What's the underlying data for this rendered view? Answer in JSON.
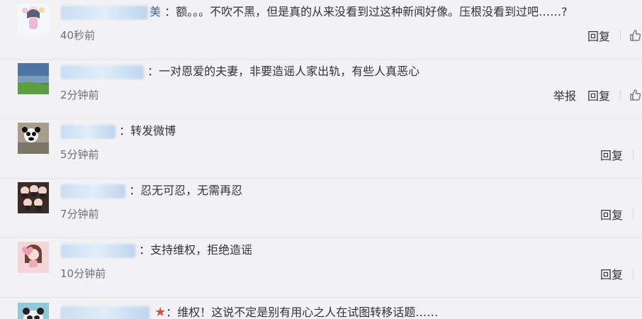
{
  "comments": [
    {
      "username_visible": "美",
      "text": "额。。。不吹不黑，但是真的从来没看到过这种新闻好像。压根没看到过吧……?",
      "time": "40秒前",
      "actions": {
        "reply": "回复"
      }
    },
    {
      "username_visible": "",
      "text": "一对恩爱的夫妻，非要造谣人家出轨，有些人真恶心",
      "time": "2分钟前",
      "actions": {
        "report": "举报",
        "reply": "回复"
      }
    },
    {
      "username_visible": "",
      "text": "转发微博",
      "time": "5分钟前",
      "actions": {
        "reply": "回复"
      }
    },
    {
      "username_visible": "",
      "text": "忍无可忍，无需再忍",
      "time": "7分钟前",
      "actions": {
        "reply": "回复"
      }
    },
    {
      "username_visible": "",
      "text": "支持维权，拒绝造谣",
      "time": "10分钟前",
      "actions": {
        "reply": "回复"
      }
    },
    {
      "username_visible": "",
      "text": "维权！这说不定是别有用心之人在试图转移话题……",
      "time": "",
      "actions": {}
    }
  ],
  "colors": {
    "background": "#f2f2f5",
    "text": "#333333",
    "username": "#3d6aa8",
    "meta": "#6f6f6f",
    "divider": "#d6d6dc",
    "badge": "#e04b3b"
  },
  "icons": {
    "like": "thumbs-up-icon",
    "badge": "star-icon"
  }
}
